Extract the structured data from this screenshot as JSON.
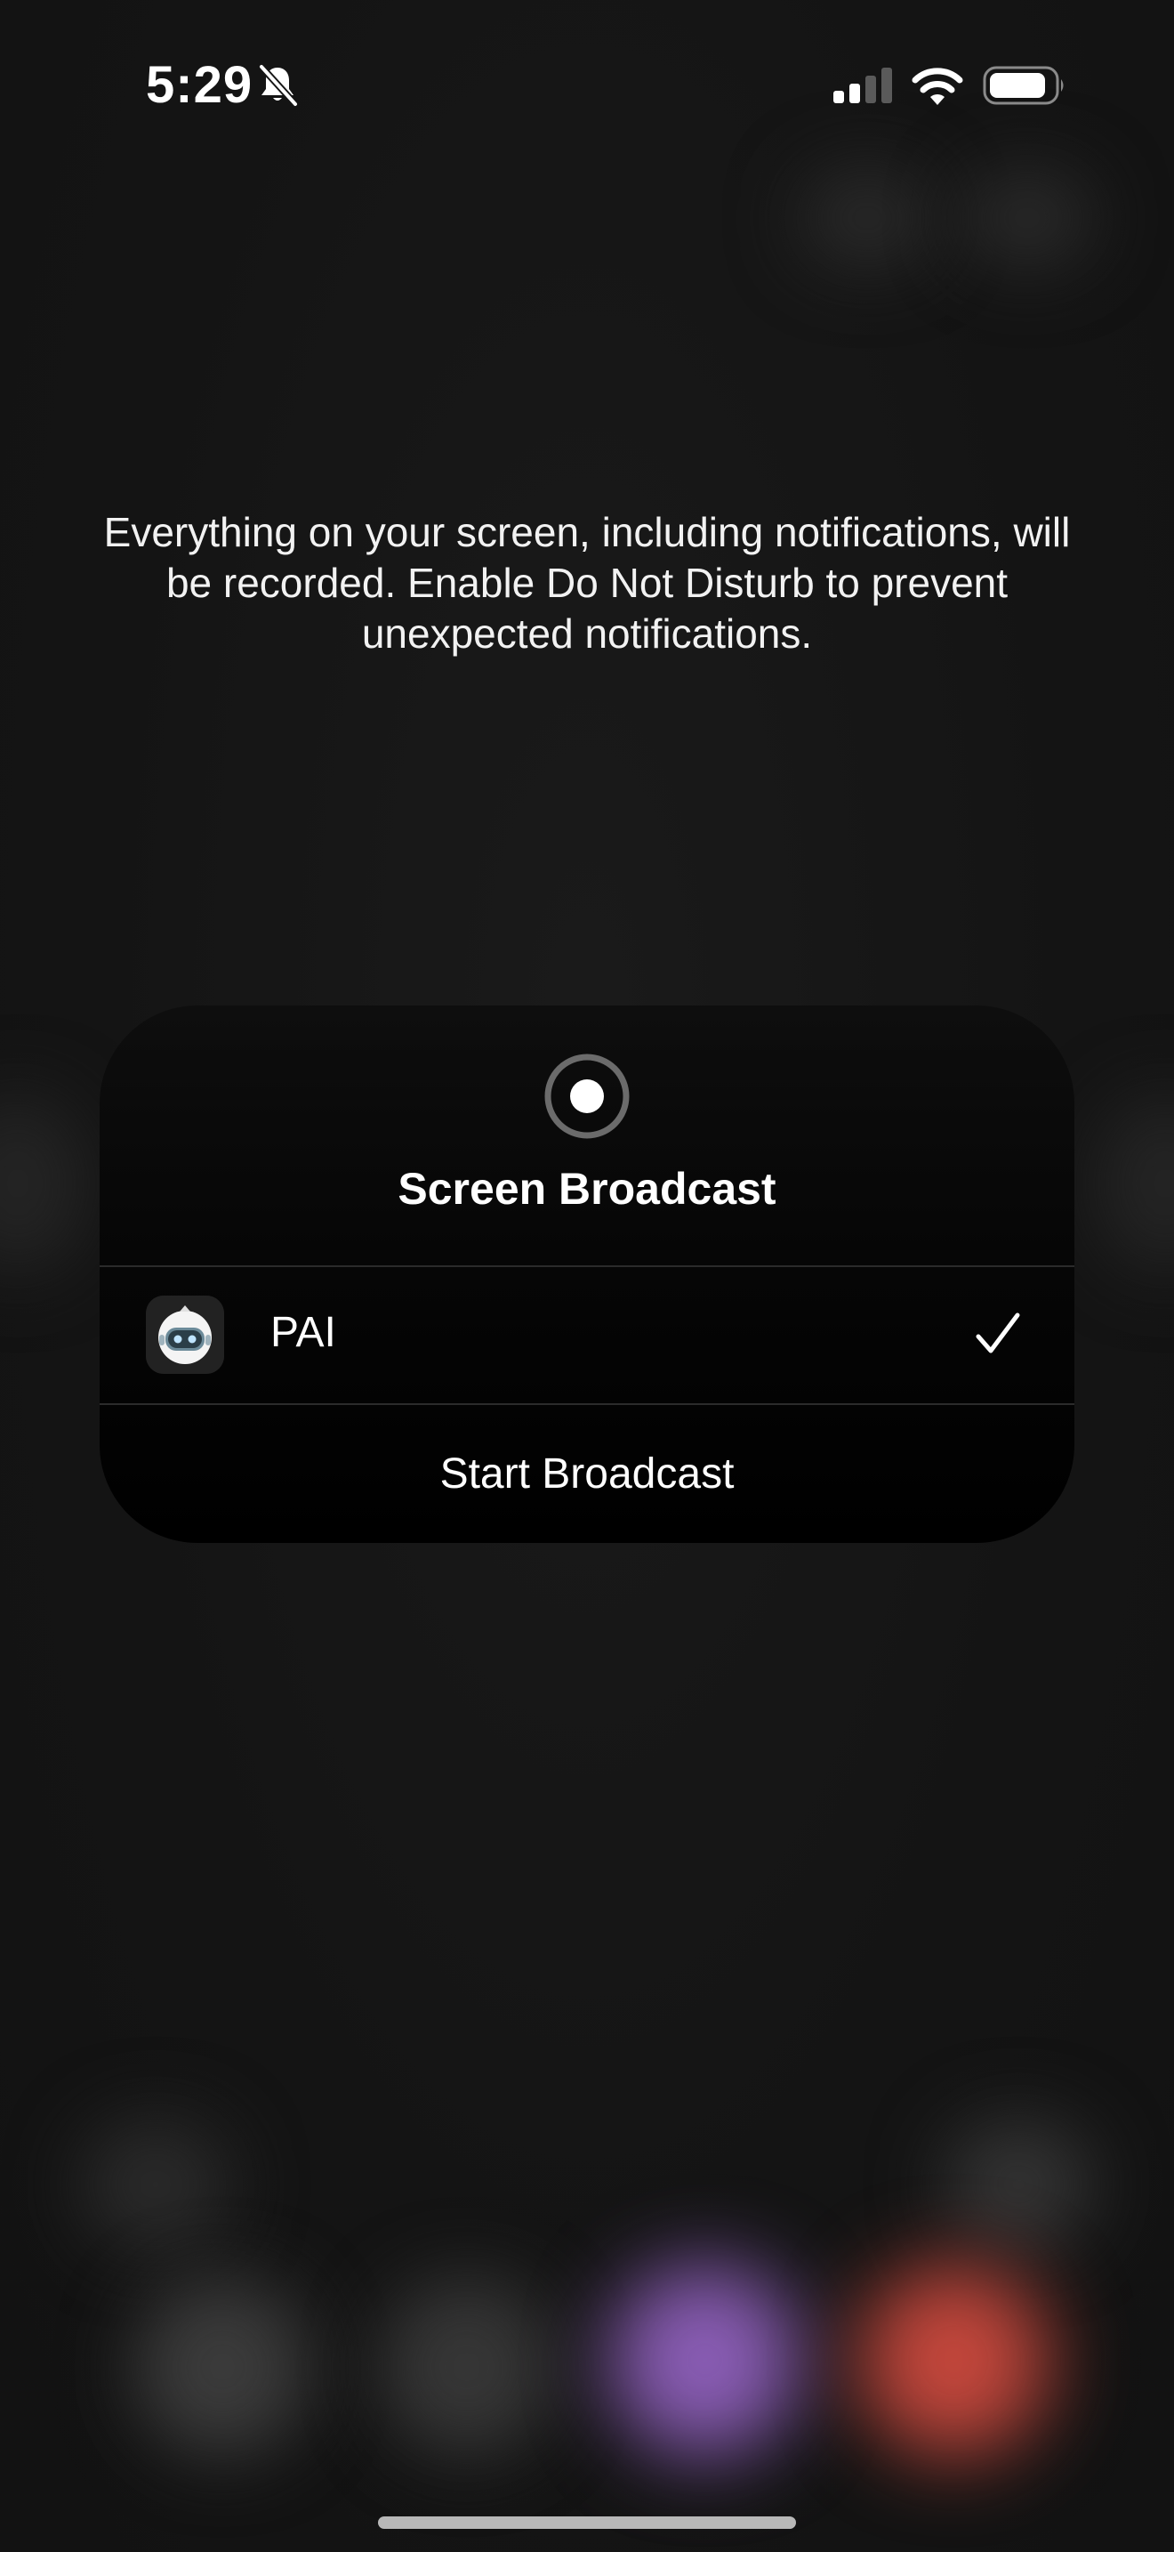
{
  "status_bar": {
    "time": "5:29",
    "icons": [
      "bell-slash-icon",
      "cellular-signal-icon",
      "wifi-icon",
      "battery-icon"
    ]
  },
  "message": {
    "text": "Everything on your screen, including notifications, will be recorded. Enable Do Not Disturb to prevent unexpected notifications."
  },
  "sheet": {
    "icon": "record-icon",
    "title": "Screen Broadcast",
    "apps": [
      {
        "label": "PAI",
        "icon": "robot-app-icon",
        "selected": true
      }
    ],
    "start_label": "Start Broadcast"
  },
  "colors": {
    "background": "#141414",
    "sheet": "#000000",
    "text": "#ffffff",
    "divider": "#2b2b2b",
    "dock_purple": "#8a5db5",
    "dock_red": "#c4473c"
  }
}
